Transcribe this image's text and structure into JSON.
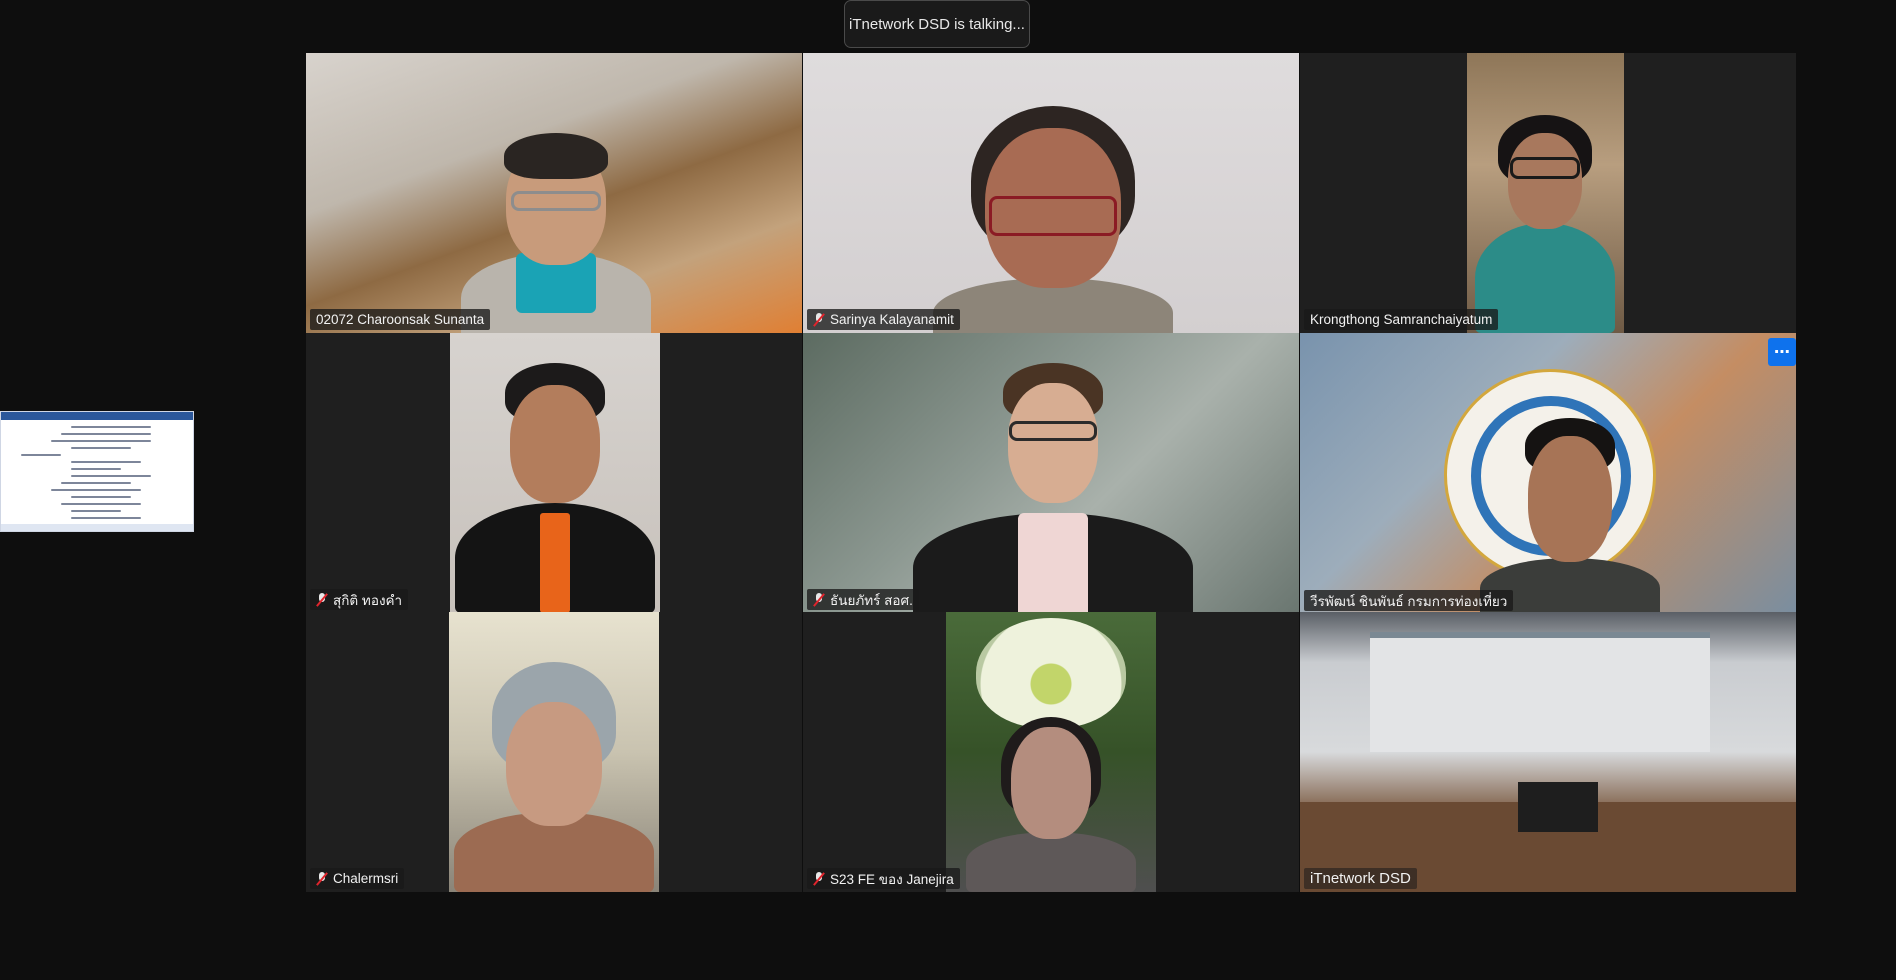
{
  "meeting": {
    "talking_indicator": "iTnetwork DSD is talking..."
  },
  "tiles": [
    {
      "name": "02072 Charoonsak Sunanta",
      "muted": false,
      "active_speaker": false
    },
    {
      "name": "Sarinya Kalayanamit",
      "muted": true,
      "active_speaker": true
    },
    {
      "name": "Krongthong Samranchaiyatum",
      "muted": false,
      "active_speaker": false
    },
    {
      "name": "สุกิติ ทองคำ",
      "muted": true,
      "active_speaker": false
    },
    {
      "name": "ธันยภัทร์ สอศ.",
      "muted": true,
      "active_speaker": false
    },
    {
      "name": "วีรพัฒน์ ชินพันธ์ กรมการท่องเที่ยว",
      "muted": false,
      "active_speaker": false,
      "more_button": "⋯"
    },
    {
      "name": "Chalermsri",
      "muted": true,
      "active_speaker": false
    },
    {
      "name": "S23 FE ของ Janejira",
      "muted": true,
      "active_speaker": false
    },
    {
      "name": "iTnetwork DSD",
      "muted": false,
      "active_speaker": false
    }
  ],
  "colors": {
    "background": "#0e0e0e",
    "tile": "#1f1f1f",
    "active_speaker_border": "#23d959",
    "muted_icon": "#e0242c",
    "more_button": "#0e72ed"
  }
}
